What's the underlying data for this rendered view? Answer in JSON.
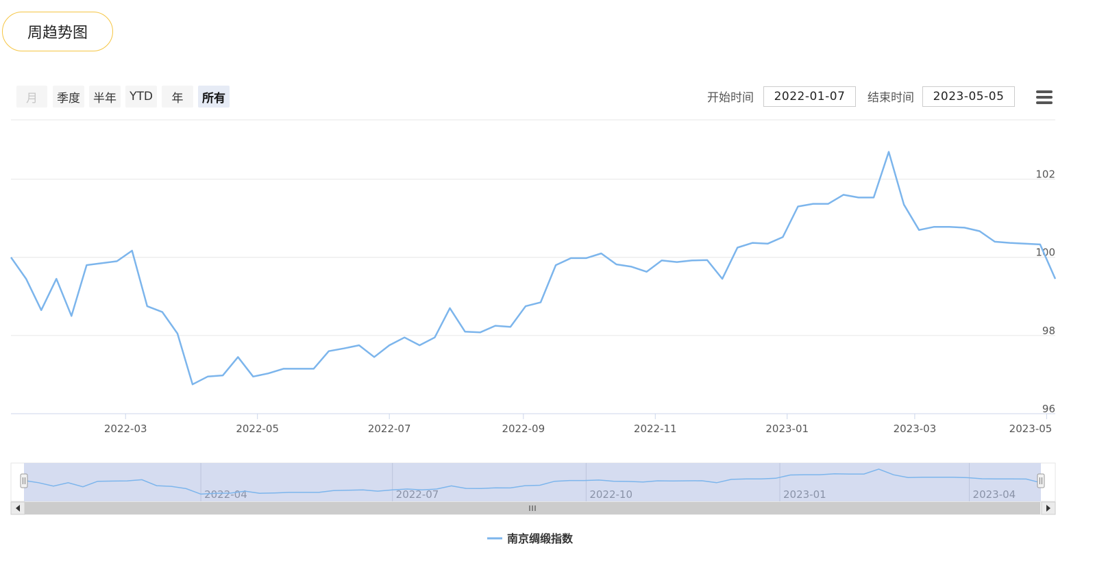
{
  "header": {
    "title": "周趋势图"
  },
  "range_selector": {
    "buttons": [
      {
        "label": "月",
        "state": "disabled"
      },
      {
        "label": "季度",
        "state": "normal"
      },
      {
        "label": "半年",
        "state": "normal"
      },
      {
        "label": "YTD",
        "state": "normal"
      },
      {
        "label": "年",
        "state": "normal"
      },
      {
        "label": "所有",
        "state": "active"
      }
    ],
    "start_label": "开始时间",
    "start_value": "2022-01-07",
    "end_label": "结束时间",
    "end_value": "2023-05-05"
  },
  "icons": {
    "menu": "hamburger-menu-icon",
    "scroll_left": "arrow-left-icon",
    "scroll_right": "arrow-right-icon",
    "scroll_grip": "grip-icon"
  },
  "colors": {
    "line": "#7cb5ec",
    "accent_border": "#f5c542",
    "navigator_mask": "#d0d8ee",
    "scrollbar": "#cccccc"
  },
  "chart_data": {
    "type": "line",
    "series": [
      {
        "name": "南京绸缎指数",
        "x": [
          "2022-01-07",
          "2022-01-14",
          "2022-01-21",
          "2022-01-28",
          "2022-02-04",
          "2022-02-11",
          "2022-02-18",
          "2022-02-25",
          "2022-03-04",
          "2022-03-11",
          "2022-03-18",
          "2022-03-25",
          "2022-04-01",
          "2022-04-08",
          "2022-04-15",
          "2022-04-22",
          "2022-04-29",
          "2022-05-06",
          "2022-05-13",
          "2022-05-20",
          "2022-05-27",
          "2022-06-03",
          "2022-06-10",
          "2022-06-17",
          "2022-06-24",
          "2022-07-01",
          "2022-07-08",
          "2022-07-15",
          "2022-07-22",
          "2022-07-29",
          "2022-08-05",
          "2022-08-12",
          "2022-08-19",
          "2022-08-26",
          "2022-09-02",
          "2022-09-09",
          "2022-09-16",
          "2022-09-23",
          "2022-09-30",
          "2022-10-07",
          "2022-10-14",
          "2022-10-21",
          "2022-10-28",
          "2022-11-04",
          "2022-11-11",
          "2022-11-18",
          "2022-11-25",
          "2022-12-02",
          "2022-12-09",
          "2022-12-16",
          "2022-12-23",
          "2022-12-30",
          "2023-01-06",
          "2023-01-13",
          "2023-01-20",
          "2023-01-27",
          "2023-02-03",
          "2023-02-10",
          "2023-02-17",
          "2023-02-24",
          "2023-03-03",
          "2023-03-10",
          "2023-03-17",
          "2023-03-24",
          "2023-03-31",
          "2023-04-07",
          "2023-04-14",
          "2023-04-21",
          "2023-04-28",
          "2023-05-05"
        ],
        "values": [
          100.0,
          99.45,
          98.65,
          99.45,
          98.5,
          99.8,
          99.85,
          99.9,
          100.17,
          98.75,
          98.6,
          98.05,
          96.75,
          96.95,
          96.98,
          97.45,
          96.95,
          97.03,
          97.15,
          97.15,
          97.15,
          97.6,
          97.67,
          97.75,
          97.45,
          97.75,
          97.95,
          97.75,
          97.95,
          98.7,
          98.1,
          98.08,
          98.25,
          98.22,
          98.75,
          98.85,
          99.8,
          99.98,
          99.98,
          100.1,
          99.82,
          99.76,
          99.63,
          99.92,
          99.88,
          99.92,
          99.93,
          99.45,
          100.25,
          100.37,
          100.35,
          100.52,
          101.3,
          101.37,
          101.37,
          101.6,
          101.53,
          101.53,
          102.7,
          101.35,
          100.7,
          100.78,
          100.78,
          100.76,
          100.67,
          100.4,
          100.37,
          100.35,
          100.33,
          99.45
        ]
      }
    ],
    "x_ticks": [
      "2022-03",
      "2022-05",
      "2022-07",
      "2022-09",
      "2022-11",
      "2023-01",
      "2023-03",
      "2023-05"
    ],
    "y_ticks": [
      96,
      98,
      100,
      102
    ],
    "ylim": [
      96,
      103.5
    ],
    "grid": true,
    "legend_position": "bottom-center",
    "navigator": {
      "ticks": [
        "2022-04",
        "2022-07",
        "2022-10",
        "2023-01",
        "2023-04"
      ],
      "range": [
        "2022-01-07",
        "2023-05-05"
      ]
    }
  }
}
